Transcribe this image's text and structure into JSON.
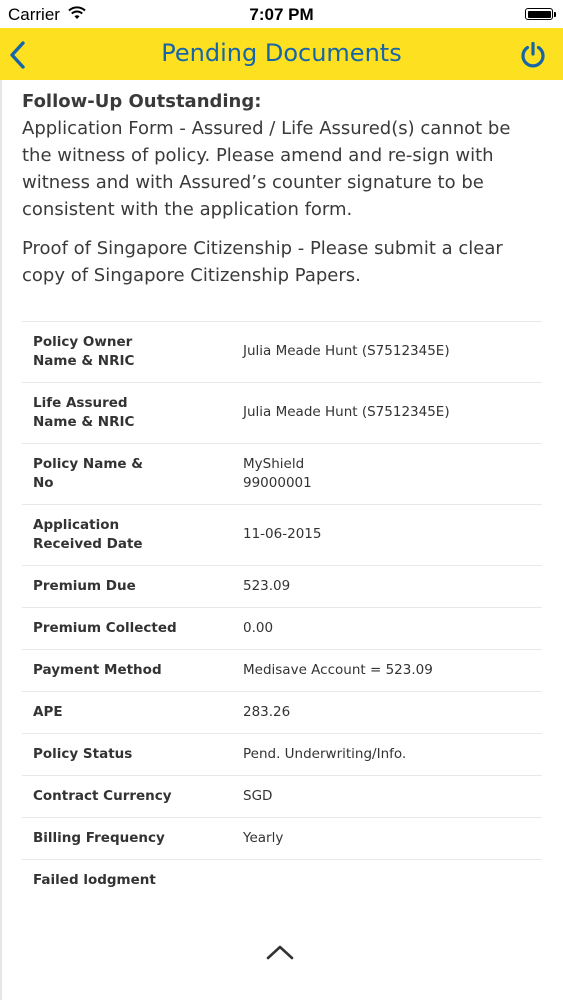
{
  "status_bar": {
    "carrier": "Carrier",
    "time": "7:07 PM"
  },
  "nav": {
    "title": "Pending Documents",
    "back_icon": "chevron-left-icon",
    "power_icon": "power-icon",
    "accent": "#fde020",
    "title_color": "#1565a8"
  },
  "follow_up": {
    "heading": "Follow-Up Outstanding:",
    "item1": "Application Form - Assured / Life Assured(s) cannot be the witness of policy. Please amend and re-sign with witness and with Assured’s counter signature to be consistent with the application form.",
    "item2": "Proof of Singapore Citizenship - Please submit a clear copy of Singapore Citizenship Papers."
  },
  "details": {
    "policy_owner": {
      "label1": "Policy Owner",
      "label2": "Name & NRIC",
      "value": "Julia Meade Hunt  (S7512345E)"
    },
    "life_assured": {
      "label1": "Life Assured",
      "label2": "Name & NRIC",
      "value": "Julia Meade Hunt  (S7512345E)"
    },
    "policy_name": {
      "label1": "Policy Name &",
      "label2": "No",
      "value1": "MyShield",
      "value2": "99000001"
    },
    "application_date": {
      "label1": "Application",
      "label2": "Received Date",
      "value": "11-06-2015"
    },
    "premium_due": {
      "label": "Premium Due",
      "value": "523.09"
    },
    "premium_collected": {
      "label": "Premium Collected",
      "value": "0.00"
    },
    "payment_method": {
      "label": "Payment Method",
      "value": "Medisave Account = 523.09"
    },
    "ape": {
      "label": "APE",
      "value": "283.26"
    },
    "policy_status": {
      "label": "Policy Status",
      "value": "Pend. Underwriting/Info."
    },
    "contract_currency": {
      "label": "Contract Currency",
      "value": "SGD"
    },
    "billing_frequency": {
      "label": "Billing Frequency",
      "value": "Yearly"
    },
    "failed_lodgment": {
      "label": "Failed lodgment",
      "value": ""
    }
  },
  "footer": {
    "collapse_icon": "chevron-up-icon"
  }
}
